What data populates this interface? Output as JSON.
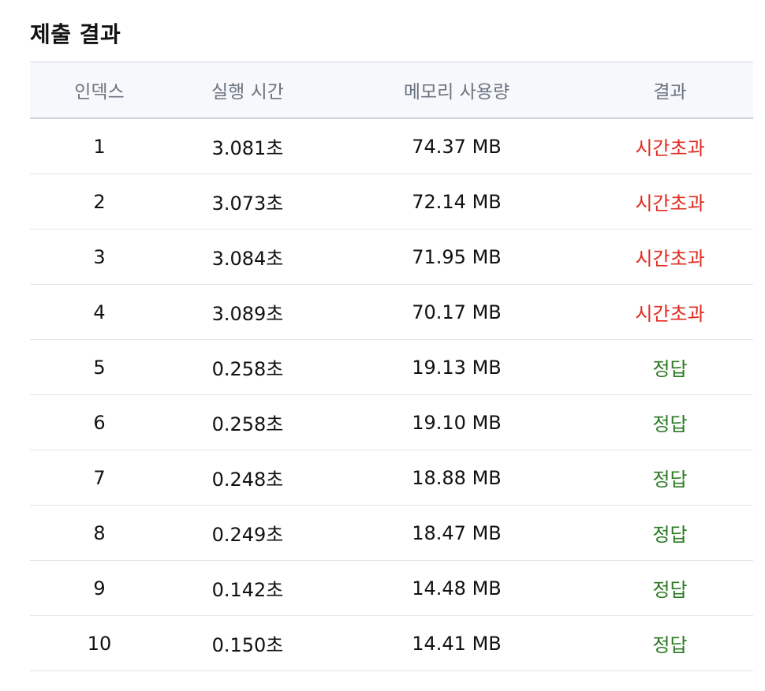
{
  "title": "제출 결과",
  "columns": [
    "인덱스",
    "실행 시간",
    "메모리 사용량",
    "결과"
  ],
  "rows": [
    {
      "index": "1",
      "time": "3.081초",
      "memory": "74.37 MB",
      "result": "시간초과",
      "status": "tle"
    },
    {
      "index": "2",
      "time": "3.073초",
      "memory": "72.14 MB",
      "result": "시간초과",
      "status": "tle"
    },
    {
      "index": "3",
      "time": "3.084초",
      "memory": "71.95 MB",
      "result": "시간초과",
      "status": "tle"
    },
    {
      "index": "4",
      "time": "3.089초",
      "memory": "70.17 MB",
      "result": "시간초과",
      "status": "tle"
    },
    {
      "index": "5",
      "time": "0.258초",
      "memory": "19.13 MB",
      "result": "정답",
      "status": "ok"
    },
    {
      "index": "6",
      "time": "0.258초",
      "memory": "19.10 MB",
      "result": "정답",
      "status": "ok"
    },
    {
      "index": "7",
      "time": "0.248초",
      "memory": "18.88 MB",
      "result": "정답",
      "status": "ok"
    },
    {
      "index": "8",
      "time": "0.249초",
      "memory": "18.47 MB",
      "result": "정답",
      "status": "ok"
    },
    {
      "index": "9",
      "time": "0.142초",
      "memory": "14.48 MB",
      "result": "정답",
      "status": "ok"
    },
    {
      "index": "10",
      "time": "0.150초",
      "memory": "14.41 MB",
      "result": "정답",
      "status": "ok"
    }
  ],
  "colors": {
    "tle": "#e02b20",
    "ok": "#2b7a22",
    "header_bg": "#f6f8fb",
    "header_text": "#6b7380"
  }
}
